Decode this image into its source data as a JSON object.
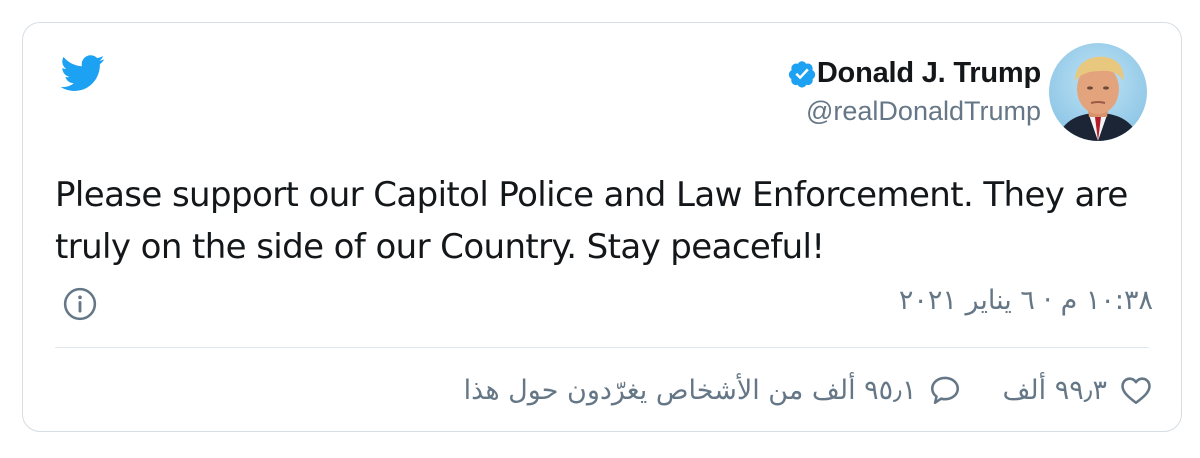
{
  "icons": {
    "brand": "twitter-bird-icon",
    "verified": "verified-badge-icon",
    "info": "info-icon",
    "like": "heart-icon",
    "reply": "speech-bubble-icon"
  },
  "colors": {
    "twitter_blue": "#1da1f2",
    "text": "#14171a",
    "secondary_text": "#657786",
    "border": "#d6dde3"
  },
  "author": {
    "display_name": "Donald J. Trump",
    "handle": "@realDonaldTrump",
    "verified": true
  },
  "tweet": {
    "text": "Please support our Capitol Police and Law Enforcement. They are truly on the side of our Country. Stay peaceful!",
    "timestamp": "١٠:٣٨ م · ٦ يناير ٢٠٢١"
  },
  "actions": {
    "likes": "٩٩٫٣ ألف",
    "replies_label": "٩٥٫١ ألف من الأشخاص يغرّدون حول هذا"
  }
}
